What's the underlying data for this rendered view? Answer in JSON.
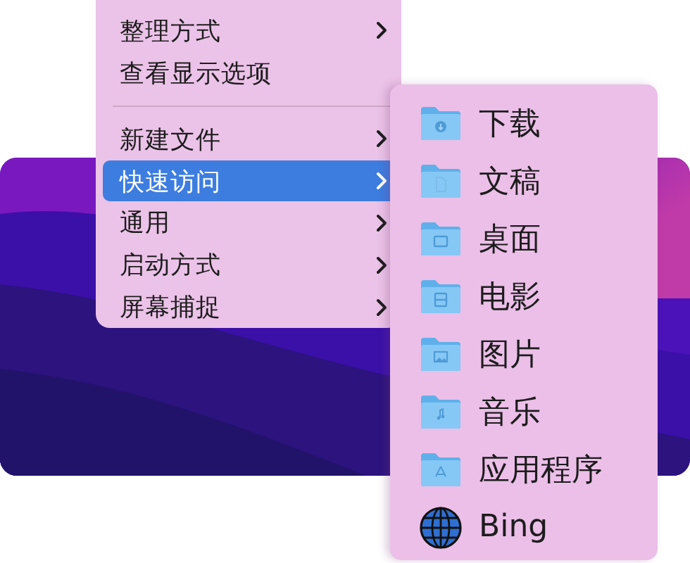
{
  "context_menu": {
    "items": [
      {
        "kind": "item",
        "label": "整理方式",
        "has_submenu": true,
        "selected": false
      },
      {
        "kind": "item",
        "label": "查看显示选项",
        "has_submenu": false,
        "selected": false
      },
      {
        "kind": "separator"
      },
      {
        "kind": "item",
        "label": "新建文件",
        "has_submenu": true,
        "selected": false
      },
      {
        "kind": "item",
        "label": "快速访问",
        "has_submenu": true,
        "selected": true
      },
      {
        "kind": "item",
        "label": "通用",
        "has_submenu": true,
        "selected": false
      },
      {
        "kind": "item",
        "label": "启动方式",
        "has_submenu": true,
        "selected": false
      },
      {
        "kind": "item",
        "label": "屏幕捕捉",
        "has_submenu": true,
        "selected": false
      }
    ]
  },
  "submenu": {
    "items": [
      {
        "kind": "folder",
        "label": "下载"
      },
      {
        "kind": "folder",
        "label": "文稿"
      },
      {
        "kind": "folder",
        "label": "桌面"
      },
      {
        "kind": "folder",
        "label": "电影"
      },
      {
        "kind": "folder",
        "label": "图片"
      },
      {
        "kind": "folder",
        "label": "音乐"
      },
      {
        "kind": "folder",
        "label": "应用程序"
      },
      {
        "kind": "globe",
        "label": "Bing"
      }
    ]
  }
}
